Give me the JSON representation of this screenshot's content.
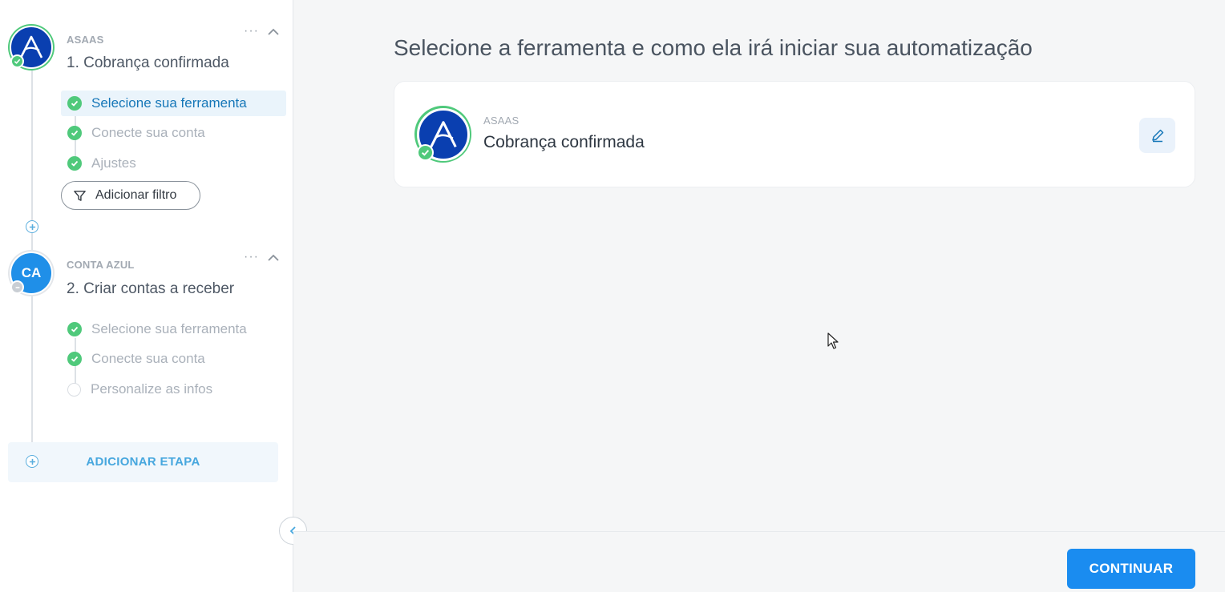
{
  "colors": {
    "accent": "#1a8cf0",
    "success": "#4fc97b",
    "asaas_brand": "#0a3fb0",
    "conta_azul_brand": "#1f8fe8",
    "active_link": "#1677b8"
  },
  "sidebar": {
    "steps": [
      {
        "app": "ASAAS",
        "title": "1. Cobrança confirmada",
        "avatar_icon": "asaas-logo-icon",
        "menu": "···",
        "substeps": [
          {
            "label": "Selecione sua ferramenta",
            "done": true,
            "active": true
          },
          {
            "label": "Conecte sua conta",
            "done": true
          },
          {
            "label": "Ajustes",
            "done": true
          }
        ],
        "filter_label": "Adicionar filtro"
      },
      {
        "app": "CONTA AZUL",
        "title": "2. Criar contas a receber",
        "avatar_text": "CA",
        "menu": "···",
        "substeps": [
          {
            "label": "Selecione sua ferramenta",
            "done": true
          },
          {
            "label": "Conecte sua conta",
            "done": true
          },
          {
            "label": "Personalize as infos",
            "done": false
          }
        ]
      }
    ],
    "add_step_label": "ADICIONAR ETAPA"
  },
  "main": {
    "heading": "Selecione a ferramenta e como ela irá iniciar sua automatização",
    "card": {
      "app": "ASAAS",
      "title": "Cobrança confirmada"
    }
  },
  "footer": {
    "continue_label": "CONTINUAR"
  }
}
